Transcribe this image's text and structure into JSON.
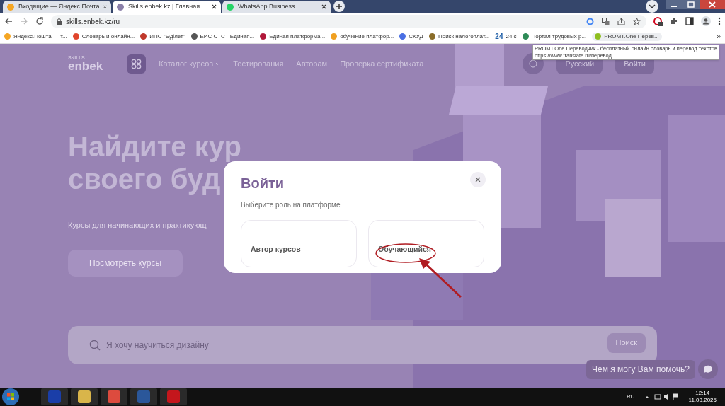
{
  "browser": {
    "tabs": [
      {
        "title": "Входящие — Яндекс Почта",
        "selected": false,
        "color": "#f5a623"
      },
      {
        "title": "Skills.enbek.kz | Главная",
        "selected": true,
        "color": "#8a7fa8"
      },
      {
        "title": "WhatsApp Business",
        "selected": false,
        "color": "#25d366"
      }
    ],
    "address": "skills.enbek.kz/ru",
    "bookmarks": [
      {
        "label": "Яндекс.Пошта — т...",
        "color": "#f5a623"
      },
      {
        "label": "Словарь и онлайн...",
        "color": "#e0452c"
      },
      {
        "label": "ИПС \"Әділет\"",
        "color": "#c0392b"
      },
      {
        "label": "ЕИС СТС - Единая...",
        "color": "#555555"
      },
      {
        "label": "Единая платформа...",
        "color": "#b0183a"
      },
      {
        "label": "обучение платфор...",
        "color": "#f0a020"
      },
      {
        "label": "СКУД",
        "color": "#4a6fe3"
      },
      {
        "label": "Поиск налогоплат...",
        "color": "#8a6d2a"
      },
      {
        "label": "24 с",
        "badge": "24",
        "color": "#1f5fa8"
      },
      {
        "label": "Портал трудовых р...",
        "color": "#2e8b57"
      },
      {
        "label": "PROMT.One Перев...",
        "color": "#8fbf1f"
      }
    ],
    "overflow": "»",
    "tooltip": {
      "title": "PROMT.One Переводчик - бесплатный онлайн словарь и перевод текстов",
      "url": "https://www.translate.ru/перевод"
    }
  },
  "site": {
    "logo_small": "SKILLS",
    "logo": "enbek",
    "nav": [
      {
        "label": "Каталог курсов",
        "dropdown": true
      },
      {
        "label": "Тестирования",
        "dropdown": false
      },
      {
        "label": "Авторам",
        "dropdown": false
      },
      {
        "label": "Проверка сертификата",
        "dropdown": false
      }
    ],
    "language": "Русский",
    "login": "Войти",
    "hero": {
      "title_lines": [
        "Найдите кур",
        "своего буд"
      ],
      "subtitle": "Курсы для начинающих и практикующ",
      "button": "Посмотреть курсы"
    },
    "search": {
      "placeholder": "Я хочу научиться дизайну",
      "button": "Поиск"
    },
    "chat": "Чем я могу Вам помочь?"
  },
  "modal": {
    "title": "Войти",
    "subtitle": "Выберите роль на платформе",
    "roles": [
      {
        "label": "Автор курсов",
        "highlighted": false
      },
      {
        "label": "Обучающийся",
        "highlighted": true
      }
    ]
  },
  "taskbar": {
    "language": "RU",
    "time": "12:14",
    "date": "11.03.2025"
  }
}
